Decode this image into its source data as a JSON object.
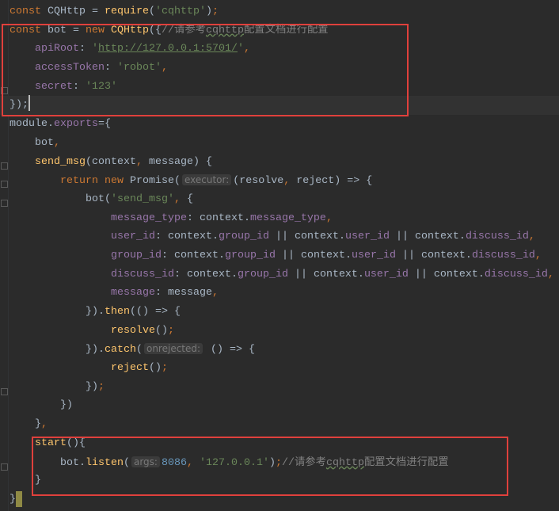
{
  "editor": {
    "current_line": 6,
    "lines": [
      [
        [
          "kw",
          "const "
        ],
        [
          "tx",
          "CQHttp = "
        ],
        [
          "fn",
          "require"
        ],
        [
          "tx",
          "("
        ],
        [
          "str",
          "'cqhttp'"
        ],
        [
          "tx",
          ")"
        ],
        [
          "kw",
          ";"
        ]
      ],
      [
        [
          "kw",
          "const "
        ],
        [
          "tx",
          "bot = "
        ],
        [
          "kw",
          "new "
        ],
        [
          "fn",
          "CQHttp"
        ],
        [
          "tx",
          "({"
        ],
        [
          "cm",
          "//请参考"
        ],
        [
          "cmw",
          "cqhttp"
        ],
        [
          "cm",
          "配置文档进行配置"
        ]
      ],
      [
        [
          "tx",
          "    "
        ],
        [
          "prop",
          "apiRoot"
        ],
        [
          "tx",
          ": "
        ],
        [
          "str",
          "'"
        ],
        [
          "url",
          "http://127.0.0.1:5701/"
        ],
        [
          "str",
          "'"
        ],
        [
          "kw",
          ","
        ]
      ],
      [
        [
          "tx",
          "    "
        ],
        [
          "prop",
          "accessToken"
        ],
        [
          "tx",
          ": "
        ],
        [
          "str",
          "'robot'"
        ],
        [
          "kw",
          ","
        ]
      ],
      [
        [
          "tx",
          "    "
        ],
        [
          "prop",
          "secret"
        ],
        [
          "tx",
          ": "
        ],
        [
          "str",
          "'123'"
        ]
      ],
      [
        [
          "tx",
          "});"
        ]
      ],
      [
        [
          "tx",
          "module."
        ],
        [
          "prop",
          "exports"
        ],
        [
          "tx",
          "={"
        ]
      ],
      [
        [
          "tx",
          "    bot"
        ],
        [
          "kw",
          ","
        ]
      ],
      [
        [
          "tx",
          "    "
        ],
        [
          "fn",
          "send_msg"
        ],
        [
          "tx",
          "(context"
        ],
        [
          "kw",
          ", "
        ],
        [
          "tx",
          "message) {"
        ]
      ],
      [
        [
          "tx",
          "        "
        ],
        [
          "kw",
          "return new "
        ],
        [
          "tx",
          "Promise("
        ],
        [
          "hint",
          "executor:"
        ],
        [
          "tx",
          "(resolve"
        ],
        [
          "kw",
          ", "
        ],
        [
          "tx",
          "reject) => {"
        ]
      ],
      [
        [
          "tx",
          "            bot("
        ],
        [
          "str",
          "'send_msg'"
        ],
        [
          "kw",
          ", "
        ],
        [
          "tx",
          "{"
        ]
      ],
      [
        [
          "tx",
          "                "
        ],
        [
          "prop",
          "message_type"
        ],
        [
          "tx",
          ": context."
        ],
        [
          "prop",
          "message_type"
        ],
        [
          "kw",
          ","
        ]
      ],
      [
        [
          "tx",
          "                "
        ],
        [
          "prop",
          "user_id"
        ],
        [
          "tx",
          ": context."
        ],
        [
          "prop",
          "group_id"
        ],
        [
          "tx",
          " || context."
        ],
        [
          "prop",
          "user_id"
        ],
        [
          "tx",
          " || context."
        ],
        [
          "prop",
          "discuss_id"
        ],
        [
          "kw",
          ","
        ]
      ],
      [
        [
          "tx",
          "                "
        ],
        [
          "prop",
          "group_id"
        ],
        [
          "tx",
          ": context."
        ],
        [
          "prop",
          "group_id"
        ],
        [
          "tx",
          " || context."
        ],
        [
          "prop",
          "user_id"
        ],
        [
          "tx",
          " || context."
        ],
        [
          "prop",
          "discuss_id"
        ],
        [
          "kw",
          ","
        ]
      ],
      [
        [
          "tx",
          "                "
        ],
        [
          "prop",
          "discuss_id"
        ],
        [
          "tx",
          ": context."
        ],
        [
          "prop",
          "group_id"
        ],
        [
          "tx",
          " || context."
        ],
        [
          "prop",
          "user_id"
        ],
        [
          "tx",
          " || context."
        ],
        [
          "prop",
          "discuss_id"
        ],
        [
          "kw",
          ","
        ]
      ],
      [
        [
          "tx",
          "                "
        ],
        [
          "prop",
          "message"
        ],
        [
          "tx",
          ": message"
        ],
        [
          "kw",
          ","
        ]
      ],
      [
        [
          "tx",
          "            })."
        ],
        [
          "fn",
          "then"
        ],
        [
          "tx",
          "(() => {"
        ]
      ],
      [
        [
          "tx",
          "                "
        ],
        [
          "fn",
          "resolve"
        ],
        [
          "tx",
          "()"
        ],
        [
          "kw",
          ";"
        ]
      ],
      [
        [
          "tx",
          "            })."
        ],
        [
          "fn",
          "catch"
        ],
        [
          "tx",
          "("
        ],
        [
          "hint",
          "onrejected:"
        ],
        [
          "tx",
          " () => {"
        ]
      ],
      [
        [
          "tx",
          "                "
        ],
        [
          "fn",
          "reject"
        ],
        [
          "tx",
          "()"
        ],
        [
          "kw",
          ";"
        ]
      ],
      [
        [
          "tx",
          "            })"
        ],
        [
          "kw",
          ";"
        ]
      ],
      [
        [
          "tx",
          "        })"
        ]
      ],
      [
        [
          "tx",
          "    }"
        ],
        [
          "kw",
          ","
        ]
      ],
      [
        [
          "tx",
          "    "
        ],
        [
          "fn",
          "start"
        ],
        [
          "tx",
          "(){"
        ]
      ],
      [
        [
          "tx",
          "        bot."
        ],
        [
          "fn",
          "listen"
        ],
        [
          "tx",
          "("
        ],
        [
          "hint",
          "args:"
        ],
        [
          "num",
          "8086"
        ],
        [
          "kw",
          ", "
        ],
        [
          "str",
          "'127.0.0.1'"
        ],
        [
          "tx",
          ")"
        ],
        [
          "kw",
          ";"
        ],
        [
          "cm",
          "//请参考"
        ],
        [
          "cmw",
          "cqhttp"
        ],
        [
          "cm",
          "配置文档进行配置"
        ]
      ],
      [
        [
          "tx",
          "    }"
        ]
      ],
      [
        [
          "tx",
          "}"
        ]
      ]
    ]
  },
  "colors": {
    "background": "#2b2b2b",
    "keyword": "#cc7832",
    "string": "#6a8759",
    "property": "#9876aa",
    "function": "#ffc66d",
    "comment": "#808080",
    "number": "#6897bb",
    "highlight_box": "#e0403c"
  }
}
